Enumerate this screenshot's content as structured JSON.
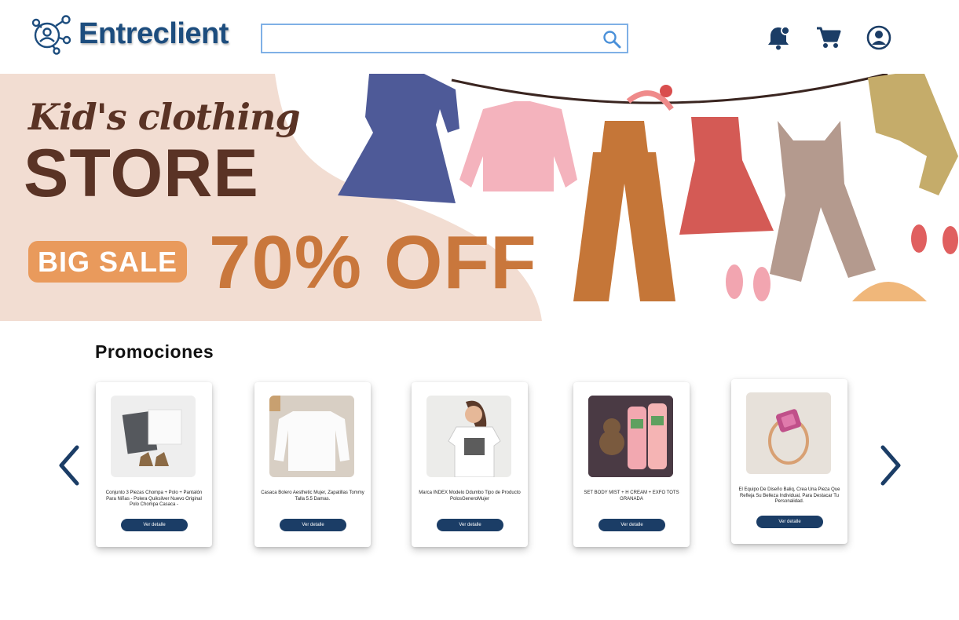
{
  "header": {
    "brand": "Entreclient",
    "search_placeholder": "",
    "search_value": ""
  },
  "banner": {
    "line1": "Kid's clothing",
    "line2": "STORE",
    "badge": "BIG SALE",
    "discount": "70% OFF"
  },
  "promotions": {
    "title": "Promociones",
    "cards": [
      {
        "description": "Conjunto 3 Piezas Chompa + Polo + Pantalón Para Niñas - Polera Quiksilver Nuevo Original Polo Chompa Casaca -",
        "button": "Ver detalle"
      },
      {
        "description": "Casaca Bolero Aesthetic Mujer, Zapatillas Tommy Talla 5.5 Damas.",
        "button": "Ver detalle"
      },
      {
        "description": "Marca INDEX Modelo Ddumbo Tipo de Producto PolosGeneroMujer",
        "button": "Ver detalle"
      },
      {
        "description": "SET BODY MIST + H CREAM + EXFO TOTS GRANADA",
        "button": "Ver detalle"
      },
      {
        "description": "El Equipo De Diseño Baliq, Crea Una Pieza Que Refleja Su Belleza Individual, Para Destacar Tu Personalidad.",
        "button": "Ver detalle"
      }
    ]
  },
  "colors": {
    "brand": "#1d4d7e",
    "button": "#1b3d66",
    "banner_bg": "#f2ddd2",
    "accent_orange": "#e99a5c"
  }
}
